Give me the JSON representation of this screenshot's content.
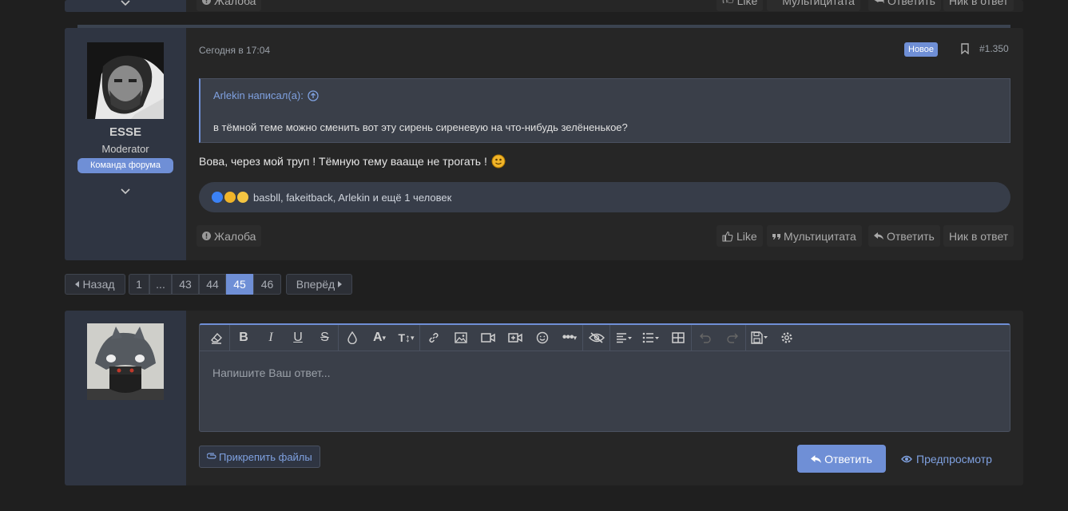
{
  "prev_post": {
    "report_label": "Жалоба",
    "like_label": "Like",
    "multiquote_label": "Мультицитата",
    "reply_label": "Ответить",
    "nick_label": "Ник в ответ"
  },
  "post": {
    "username": "ESSE",
    "user_title": "Moderator",
    "user_banner": "Команда форума",
    "date": "Сегодня в 17:04",
    "new_badge": "Новое",
    "post_number": "#1.350",
    "quote": {
      "author": "Arlekin написал(а):",
      "text": "в тёмной теме можно сменить вот эту сирень сиреневую на что-нибудь зелёненькое?"
    },
    "message": "Вова, через мой труп ! Тёмную тему вааще не трогать !",
    "reactions_text": "basbll, fakeitback, Arlekin и ещё 1 человек",
    "actions": {
      "report_label": "Жалоба",
      "like_label": "Like",
      "multiquote_label": "Мультицитата",
      "reply_label": "Ответить",
      "nick_label": "Ник в ответ"
    }
  },
  "pagination": {
    "prev_label": "Назад",
    "pages": [
      "1",
      "...",
      "43",
      "44",
      "45",
      "46"
    ],
    "current_page": "45",
    "next_label": "Вперёд"
  },
  "reply_box": {
    "placeholder": "Напишите Ваш ответ...",
    "attach_label": "Прикрепить файлы",
    "submit_label": "Ответить",
    "preview_label": "Предпросмотр",
    "toolbar_icons": [
      "eraser-icon",
      "bold-icon",
      "italic-icon",
      "underline-icon",
      "strikethrough-icon",
      "text-color-icon",
      "font-family-icon",
      "font-size-icon",
      "link-icon",
      "image-icon",
      "video-icon",
      "media-icon",
      "emoji-icon",
      "more-icon",
      "spoiler-icon",
      "align-icon",
      "list-icon",
      "table-icon",
      "undo-icon",
      "redo-icon",
      "drafts-icon",
      "settings-icon"
    ]
  },
  "colors": {
    "accent": "#6f8fd6",
    "background": "#1f1f1f",
    "panel": "#262626",
    "user_column": "#2f3542"
  }
}
